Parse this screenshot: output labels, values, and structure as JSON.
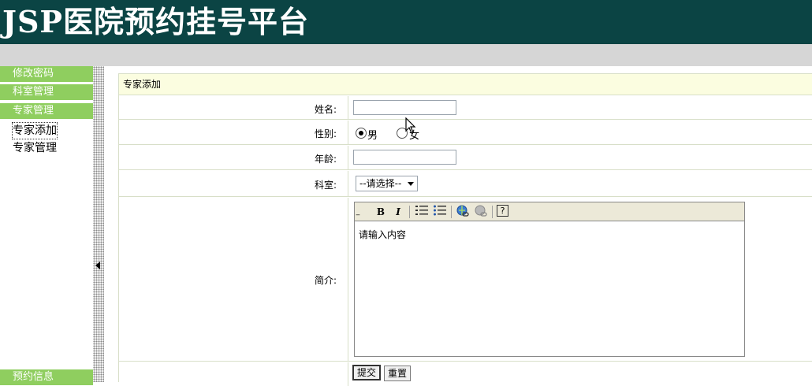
{
  "app": {
    "title": "JSP医院预约挂号平台"
  },
  "sidebar": {
    "headers": [
      {
        "label": "修改密码"
      },
      {
        "label": "科室管理"
      },
      {
        "label": "专家管理"
      }
    ],
    "sub_items": [
      {
        "label": "专家添加"
      },
      {
        "label": "专家管理"
      }
    ],
    "bottom_header": {
      "label": "预约信息"
    }
  },
  "panel": {
    "title": "专家添加"
  },
  "form": {
    "name_label": "姓名:",
    "name_value": "",
    "gender_label": "性别:",
    "gender_male": "男",
    "gender_female": "女",
    "gender_selected": "男",
    "age_label": "年龄:",
    "age_value": "",
    "dept_label": "科室:",
    "dept_selected": "--请选择--",
    "intro_label": "简介:",
    "intro_content": "请输入内容",
    "submit_label": "提交",
    "reset_label": "重置"
  },
  "toolbar": {
    "bold_icon": "B",
    "italic_icon": "I",
    "help_icon": "?"
  },
  "colors": {
    "header_bg": "#0b4444",
    "menu_green": "#8fce5f",
    "panel_title_bg": "#fbfde0",
    "border": "#d8dfc8"
  }
}
